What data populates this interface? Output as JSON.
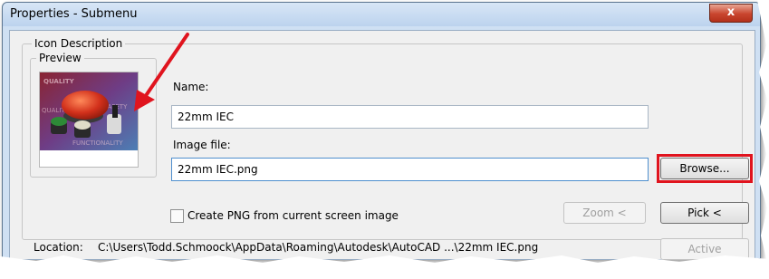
{
  "window": {
    "title": "Properties - Submenu",
    "close_glyph": "x"
  },
  "icon_group": {
    "label": "Icon Description",
    "preview_label": "Preview",
    "preview_image": "pushbutton-product-image"
  },
  "name_field": {
    "label": "Name:",
    "value": "22mm IEC"
  },
  "image_field": {
    "label": "Image file:",
    "value": "22mm IEC.png"
  },
  "buttons": {
    "browse": "Browse...",
    "zoom": "Zoom <",
    "pick": "Pick <",
    "active": "Active"
  },
  "checkbox": {
    "label": "Create PNG from current screen image",
    "checked": false
  },
  "location": {
    "label": "Location:",
    "path": "C:\\Users\\Todd.Schmoock\\AppData\\Roaming\\Autodesk\\AutoCAD ...\\22mm IEC.png"
  },
  "colors": {
    "annotation_red": "#e0141e",
    "dialog_frame": "#cfe0f3",
    "close_button": "#c9452e"
  }
}
